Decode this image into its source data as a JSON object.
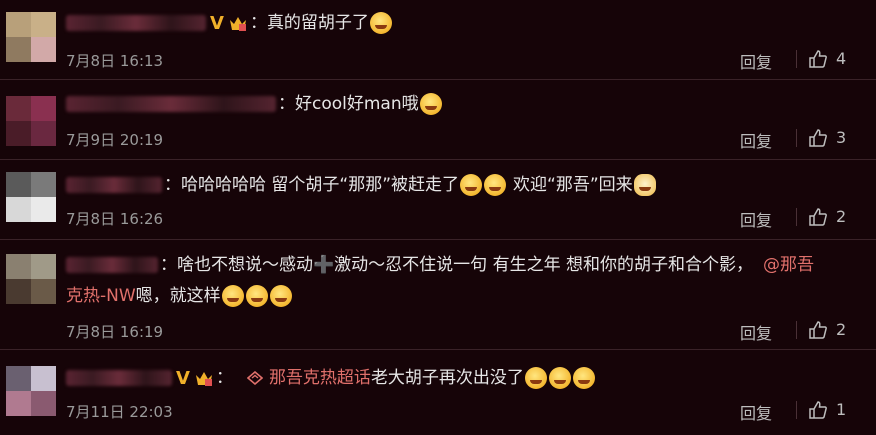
{
  "comments": [
    {
      "colon": "：",
      "text": "真的留胡子了",
      "date": "7月8日 16:13",
      "reply": "回复",
      "likes": "4",
      "emojis": [
        "laugh-emoji"
      ]
    },
    {
      "colon": "：",
      "text": "好cool好man哦",
      "date": "7月9日 20:19",
      "reply": "回复",
      "likes": "3",
      "emojis": [
        "heart-eyes-emoji"
      ]
    },
    {
      "colon": "：",
      "text_a": "哈哈哈哈哈 留个胡子“那那”被赶走了",
      "text_b": "欢迎“那吾”回来",
      "date": "7月8日 16:26",
      "reply": "回复",
      "likes": "2",
      "emojis": [
        "tears-of-joy-emoji",
        "tears-of-joy-emoji",
        "doge-emoji"
      ]
    },
    {
      "colon": "：",
      "text": "啥也不想说～感动➕激动～忍不住说一句 有生之年 想和你的胡子和合个影，",
      "mention_a": "@那吾",
      "mention_b": "克热-NW",
      "text_after": " 嗯，就这样",
      "date": "7月8日 16:19",
      "reply": "回复",
      "likes": "2",
      "emojis": [
        "pleading-emoji",
        "pleading-emoji",
        "pleading-emoji"
      ]
    },
    {
      "colon": "：",
      "topic": "那吾克热超话",
      "text": " 老大胡子再次出没了",
      "date": "7月11日 22:03",
      "reply": "回复",
      "likes": "1",
      "emojis": [
        "grin-emoji",
        "grin-emoji",
        "grin-emoji"
      ]
    }
  ],
  "colors": {
    "background": "#160408",
    "mention": "#e0706b",
    "vip": "#f0b02a"
  }
}
